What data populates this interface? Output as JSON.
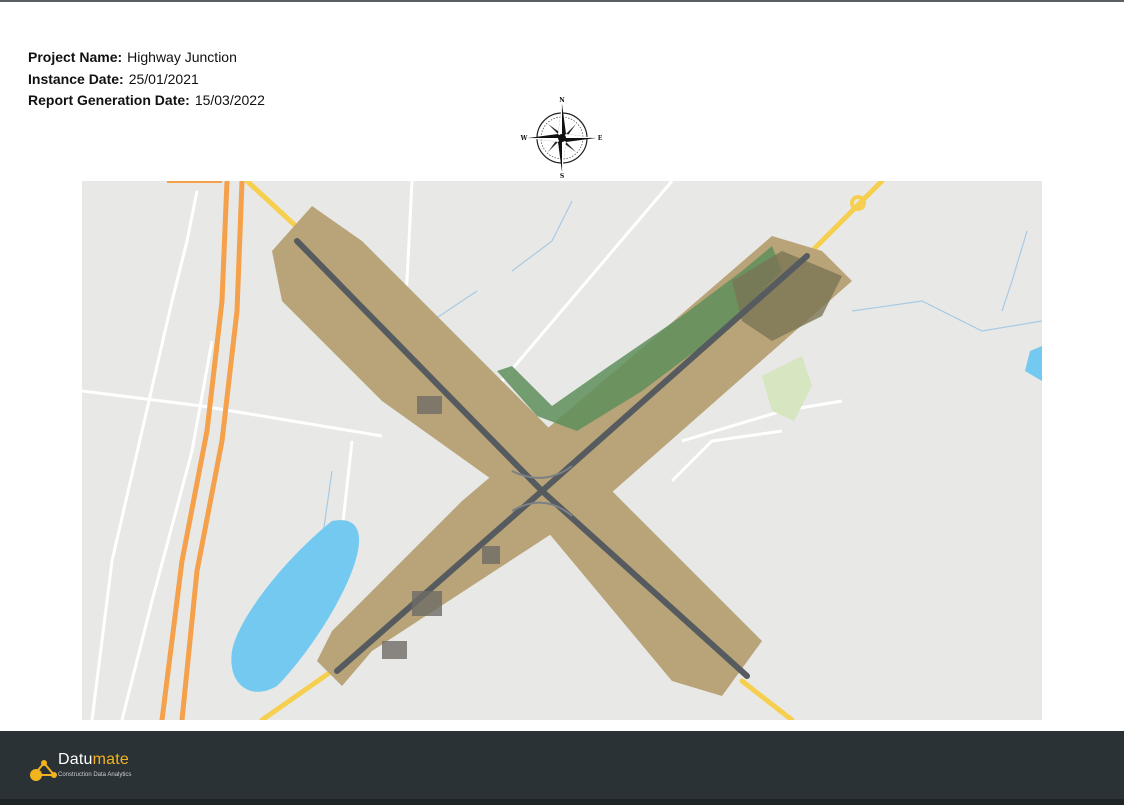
{
  "report": {
    "project_label": "Project Name:",
    "project_value": "Highway Junction",
    "instance_label": "Instance Date:",
    "instance_value": "25/01/2021",
    "generation_label": "Report Generation Date:",
    "generation_value": "15/03/2022"
  },
  "compass": {
    "north": "N",
    "south": "S",
    "east": "E",
    "west": "W"
  },
  "map": {
    "icon": "orthomosaic-map",
    "colors": {
      "background": "#e8e8e6",
      "highway_orange": "#f5a04a",
      "road_yellow": "#f6cf4f",
      "water": "#73c9f0",
      "park": "#d6e6c0",
      "terrain": "#b9a479",
      "vegetation": "#5e8f5a"
    }
  },
  "footer": {
    "brand_part1": "Datu",
    "brand_part2": "mate",
    "tagline": "Construction Data Analytics",
    "colors": {
      "bar": "#2b3236",
      "accent": "#f2b31e"
    }
  }
}
